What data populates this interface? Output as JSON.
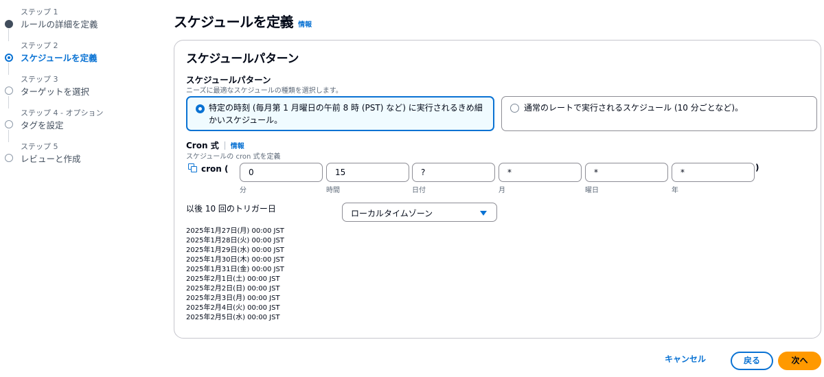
{
  "wizard": {
    "steps": [
      {
        "number_label": "ステップ 1",
        "title": "ルールの詳細を定義",
        "state": "completed"
      },
      {
        "number_label": "ステップ 2",
        "title": "スケジュールを定義",
        "state": "current"
      },
      {
        "number_label": "ステップ 3",
        "title": "ターゲットを選択",
        "state": "future"
      },
      {
        "number_label": "ステップ 4 - オプション",
        "title": "タグを設定",
        "state": "future"
      },
      {
        "number_label": "ステップ 5",
        "title": "レビューと作成",
        "state": "future"
      }
    ]
  },
  "header": {
    "title": "スケジュールを定義",
    "info_link": "情報"
  },
  "schedule": {
    "container_title": "スケジュールパターン",
    "pattern_label": "スケジュールパターン",
    "pattern_description": "ニーズに最適なスケジュールの種類を選択します。",
    "options": [
      {
        "label": "特定の時刻 (毎月第 1 月曜日の午前 8 時 (PST) など) に実行されるきめ細かいスケジュール。",
        "selected": true
      },
      {
        "label": "通常のレートで実行されるスケジュール (10 分ごとなど)。",
        "selected": false
      }
    ],
    "cron": {
      "label": "Cron 式",
      "info_link": "情報",
      "description": "スケジュールの cron 式を定義",
      "prefix": "cron (",
      "suffix": ")",
      "fields": [
        {
          "value": "0",
          "sublabel": "分"
        },
        {
          "value": "15",
          "sublabel": "時間"
        },
        {
          "value": "?",
          "sublabel": "日付"
        },
        {
          "value": "*",
          "sublabel": "月"
        },
        {
          "value": "*",
          "sublabel": "曜日"
        },
        {
          "value": "*",
          "sublabel": "年"
        }
      ]
    },
    "triggers": {
      "label": "以後 10 回のトリガー日",
      "timezone_selected": "ローカルタイムゾーン",
      "dates": [
        "2025年1月27日(月) 00:00 JST",
        "2025年1月28日(火) 00:00 JST",
        "2025年1月29日(水) 00:00 JST",
        "2025年1月30日(木) 00:00 JST",
        "2025年1月31日(金) 00:00 JST",
        "2025年2月1日(土) 00:00 JST",
        "2025年2月2日(日) 00:00 JST",
        "2025年2月3日(月) 00:00 JST",
        "2025年2月4日(火) 00:00 JST",
        "2025年2月5日(水) 00:00 JST"
      ]
    }
  },
  "footer": {
    "cancel_label": "キャンセル",
    "back_label": "戻る",
    "next_label": "次へ"
  },
  "colors": {
    "accent": "#0972d3",
    "primary_button": "#ff9900",
    "selected_tile_bg": "#f0fbff"
  }
}
